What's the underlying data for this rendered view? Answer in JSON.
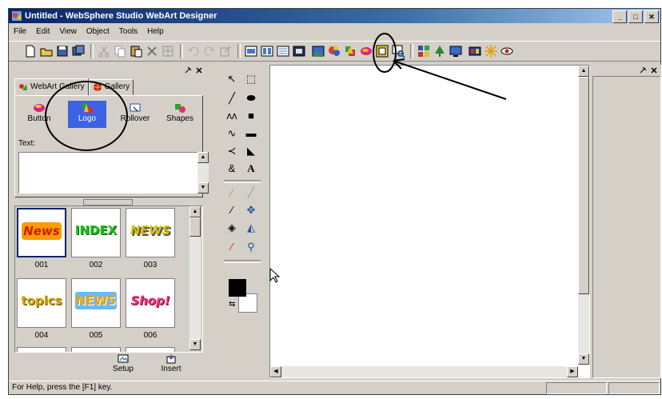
{
  "window": {
    "title": "Untitled - WebSphere Studio WebArt Designer",
    "controls": [
      "_",
      "□",
      "✕"
    ]
  },
  "menubar": [
    "File",
    "Edit",
    "View",
    "Object",
    "Tools",
    "Help"
  ],
  "left_panel": {
    "tabs": [
      {
        "label": "WebArt Gallery",
        "active": true
      },
      {
        "label": "Gallery",
        "active": false
      }
    ],
    "types": [
      {
        "label": "Button",
        "icon": "button-icon",
        "selected": false
      },
      {
        "label": "Logo",
        "icon": "logo-icon",
        "selected": true
      },
      {
        "label": "Rollover",
        "icon": "rollover-icon",
        "selected": false
      },
      {
        "label": "Shapes",
        "icon": "shapes-icon",
        "selected": false
      }
    ],
    "text_label": "Text:",
    "text_value": "",
    "thumbnails": [
      {
        "label": "001",
        "art": "News",
        "color": "#f08a00",
        "bg": "#ff9a00"
      },
      {
        "label": "002",
        "art": "INDEX",
        "color": "#22bb22",
        "bg": ""
      },
      {
        "label": "003",
        "art": "NEWS",
        "color": "#d4c200",
        "bg": ""
      },
      {
        "label": "004",
        "art": "topics",
        "color": "#d8a800",
        "bg": ""
      },
      {
        "label": "005",
        "art": "NEWS",
        "color": "#f0a000",
        "bg": "#66bbff"
      },
      {
        "label": "006",
        "art": "Shop!",
        "color": "#ee3377",
        "bg": ""
      }
    ],
    "actions": [
      {
        "label": "Setup",
        "icon": "setup-icon"
      },
      {
        "label": "Insert",
        "icon": "insert-icon"
      }
    ]
  },
  "status": {
    "text": "For Help, press the [F1] key."
  },
  "colors": {
    "accent": "#3d63e4",
    "title_start": "#0a246a",
    "annotation": "#000000"
  }
}
